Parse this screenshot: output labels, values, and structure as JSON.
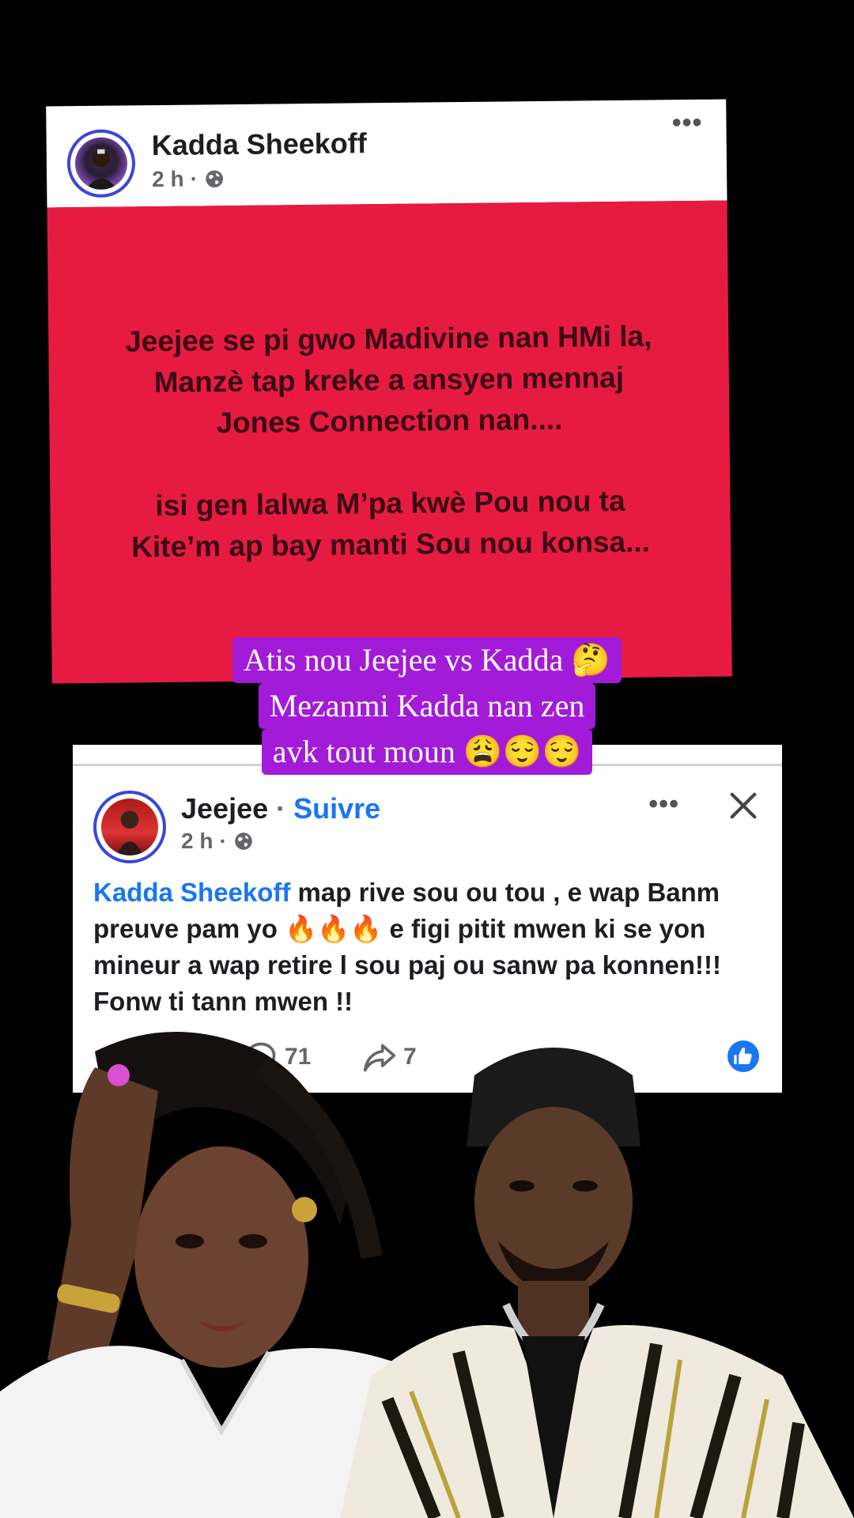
{
  "post1": {
    "author": "Kadda Sheekoff",
    "time": "2 h",
    "more": "•••",
    "paragraph1": "Jeejee se pi gwo Madivine nan HMi la, Manzè tap kreke a ansyen mennaj Jones Connection nan....",
    "paragraph2": "isi gen lalwa M’pa kwè Pou nou ta Kite’m ap bay manti Sou nou konsa...",
    "bg_color": "#e71b41",
    "text_color": "#3a0b14"
  },
  "caption": {
    "line1": "Atis nou Jeejee vs Kadda 🤔",
    "line2": "Mezanmi Kadda nan zen",
    "line3": "avk tout moun 😩😌😌",
    "bg_color": "#a21bd8"
  },
  "post2": {
    "author": "Jeejee",
    "separator": "·",
    "follow": "Suivre",
    "time": "2 h",
    "more": "•••",
    "mention": "Kadda Sheekoff",
    "text": " map rive sou ou tou , e wap Banm preuve pam yo 🔥🔥🔥 e figi pitit mwen ki se yon mineur a wap retire l sou paj ou sanw pa konnen!!! Fonw ti tann mwen !!",
    "comments": "71",
    "shares": "7",
    "accent": "#1877f2"
  },
  "icons": {
    "globe": "globe-icon",
    "close": "close-icon",
    "comment": "comment-icon",
    "share": "share-icon",
    "like": "like-icon"
  }
}
